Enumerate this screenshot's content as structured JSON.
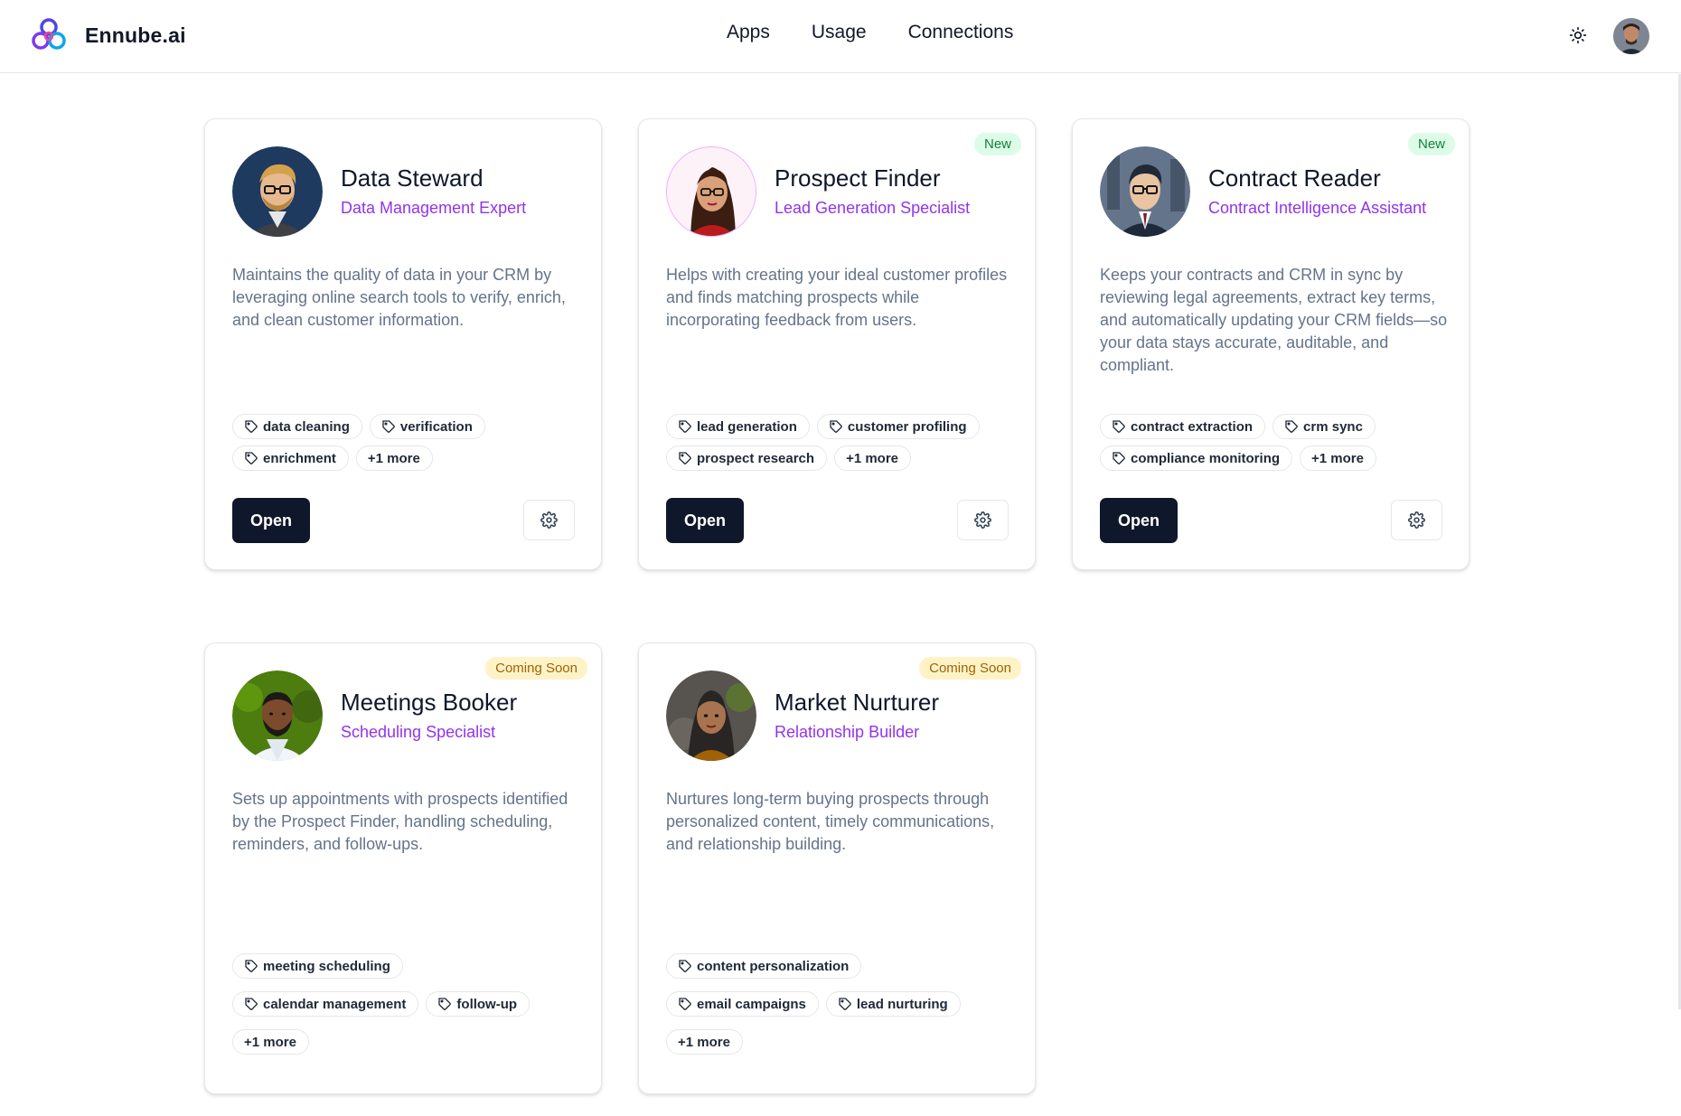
{
  "header": {
    "brand_name": "Ennube.ai",
    "nav": [
      "Apps",
      "Usage",
      "Connections"
    ]
  },
  "agents": [
    {
      "name": "Data Steward",
      "role": "Data Management Expert",
      "badge": "",
      "description": "Maintains the quality of data in your CRM by leveraging online search tools to verify, enrich, and clean customer information.",
      "tags": [
        "data cleaning",
        "verification",
        "enrichment"
      ],
      "more": "+1 more",
      "open_label": "Open"
    },
    {
      "name": "Prospect Finder",
      "role": "Lead Generation Specialist",
      "badge": "New",
      "description": "Helps with creating your ideal customer profiles and finds matching prospects while incorporating feedback from users.",
      "tags": [
        "lead generation",
        "customer profiling",
        "prospect research"
      ],
      "more": "+1 more",
      "open_label": "Open"
    },
    {
      "name": "Contract Reader",
      "role": "Contract Intelligence Assistant",
      "badge": "New",
      "description": "Keeps your contracts and CRM in sync by reviewing legal agreements, extract key terms, and automatically updating your CRM fields—so your data stays accurate, auditable, and compliant.",
      "tags": [
        "contract extraction",
        "crm sync",
        "compliance monitoring"
      ],
      "more": "+1 more",
      "open_label": "Open"
    },
    {
      "name": "Meetings Booker",
      "role": "Scheduling Specialist",
      "badge": "Coming Soon",
      "description": "Sets up appointments with prospects identified by the Prospect Finder, handling scheduling, reminders, and follow-ups.",
      "tags": [
        "meeting scheduling",
        "calendar management",
        "follow-up"
      ],
      "more": "+1 more"
    },
    {
      "name": "Market Nurturer",
      "role": "Relationship Builder",
      "badge": "Coming Soon",
      "description": "Nurtures long-term buying prospects through personalized content, timely communications, and relationship building.",
      "tags": [
        "content personalization",
        "email campaigns",
        "lead nurturing"
      ],
      "more": "+1 more"
    }
  ],
  "colors": {
    "role_text": "#9333ea",
    "primary_button": "#0f172a",
    "new_badge_bg": "#dcfce7",
    "new_badge_text": "#15803d",
    "soon_badge_bg": "#fef3c7",
    "soon_badge_text": "#a16207"
  },
  "icons": {
    "brand": "ennube-logo-icon",
    "theme": "sun-icon",
    "tag": "tag-icon",
    "settings": "gear-icon"
  }
}
